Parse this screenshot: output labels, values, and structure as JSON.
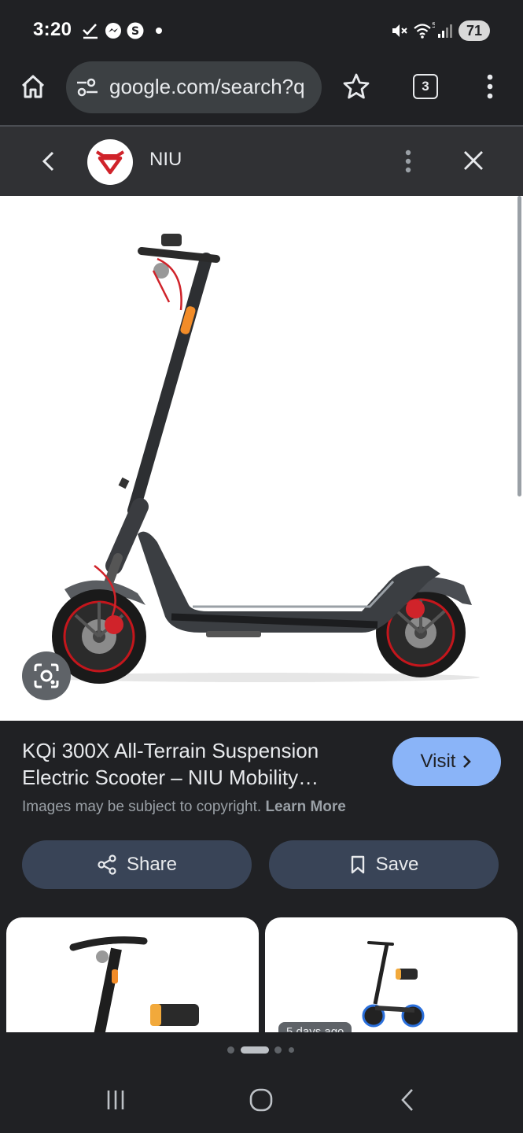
{
  "status_bar": {
    "time": "3:20",
    "battery": "71",
    "icons": [
      "checkmark-icon",
      "messenger-icon",
      "s-circle-icon",
      "dot-icon",
      "mute-icon",
      "wifi-icon",
      "signal-icon"
    ]
  },
  "browser": {
    "url": "google.com/search?q",
    "tab_count": "3",
    "icons": [
      "home-icon",
      "site-info-icon",
      "bookmark-star-icon",
      "menu-dots-icon"
    ]
  },
  "site_header": {
    "site_name": "NIU"
  },
  "result": {
    "title_line1": "KQi 300X All-Terrain Suspension",
    "title_line2": "Electric Scooter – NIU Mobility…",
    "visit_label": "Visit",
    "copyright_text": "Images may be subject to copyright.",
    "learn_more": "Learn More",
    "share_label": "Share",
    "save_label": "Save"
  },
  "related": {
    "badge": "5 days ago"
  },
  "pager": {
    "dots": 4,
    "active_index": 1
  },
  "colors": {
    "background": "#202124",
    "header": "#303134",
    "visit_button": "#8ab4f8",
    "pill_button": "#394457",
    "brand_red": "#d0232a"
  }
}
